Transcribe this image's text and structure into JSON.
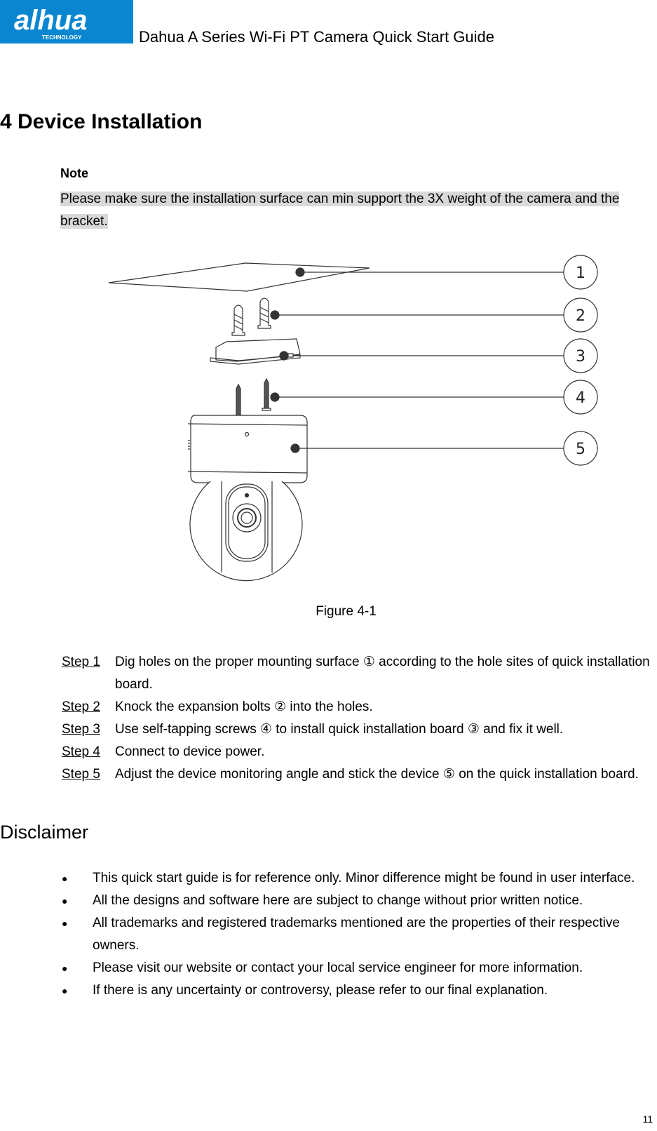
{
  "header": {
    "logo_text": "alhua",
    "logo_subtext": "TECHNOLOGY",
    "brand_color": "#0a86d0",
    "doc_title": "Dahua A Series Wi-Fi PT Camera Quick Start Guide"
  },
  "section": {
    "title": "4 Device Installation",
    "note_label": "Note",
    "note_text": "Please make sure the installation surface can min support the 3X weight of the camera and the bracket.",
    "note_highlight_color": "#d9d9d9"
  },
  "figure": {
    "callouts": [
      "1",
      "2",
      "3",
      "4",
      "5"
    ],
    "parts": [
      "mounting surface",
      "expansion bolts",
      "quick installation board",
      "self-tapping screws",
      "device"
    ],
    "caption": "Figure 4-1"
  },
  "steps": [
    {
      "label": "Step 1",
      "text": "Dig holes on the proper mounting surface ① according to the hole sites of quick installation board."
    },
    {
      "label": "Step 2",
      "text": "Knock the expansion bolts ② into the holes."
    },
    {
      "label": "Step 3",
      "text": "Use self-tapping screws ④ to install quick installation board ③ and fix it well."
    },
    {
      "label": "Step 4",
      "text": "Connect to device power."
    },
    {
      "label": "Step 5",
      "text": "Adjust the device monitoring angle and stick the device ⑤ on the quick installation board."
    }
  ],
  "disclaimer": {
    "title": "Disclaimer",
    "bullet_glyph": "●",
    "items": [
      "This quick start guide is for reference only. Minor difference might be found in user interface.",
      "All the designs and software here are subject to change without prior written notice.",
      "All trademarks and registered trademarks mentioned are the properties of their respective owners.",
      "Please visit our website or contact your local service engineer for more information.",
      "If there is any uncertainty or controversy, please refer to our final explanation."
    ]
  },
  "footer": {
    "page_number": "11"
  }
}
